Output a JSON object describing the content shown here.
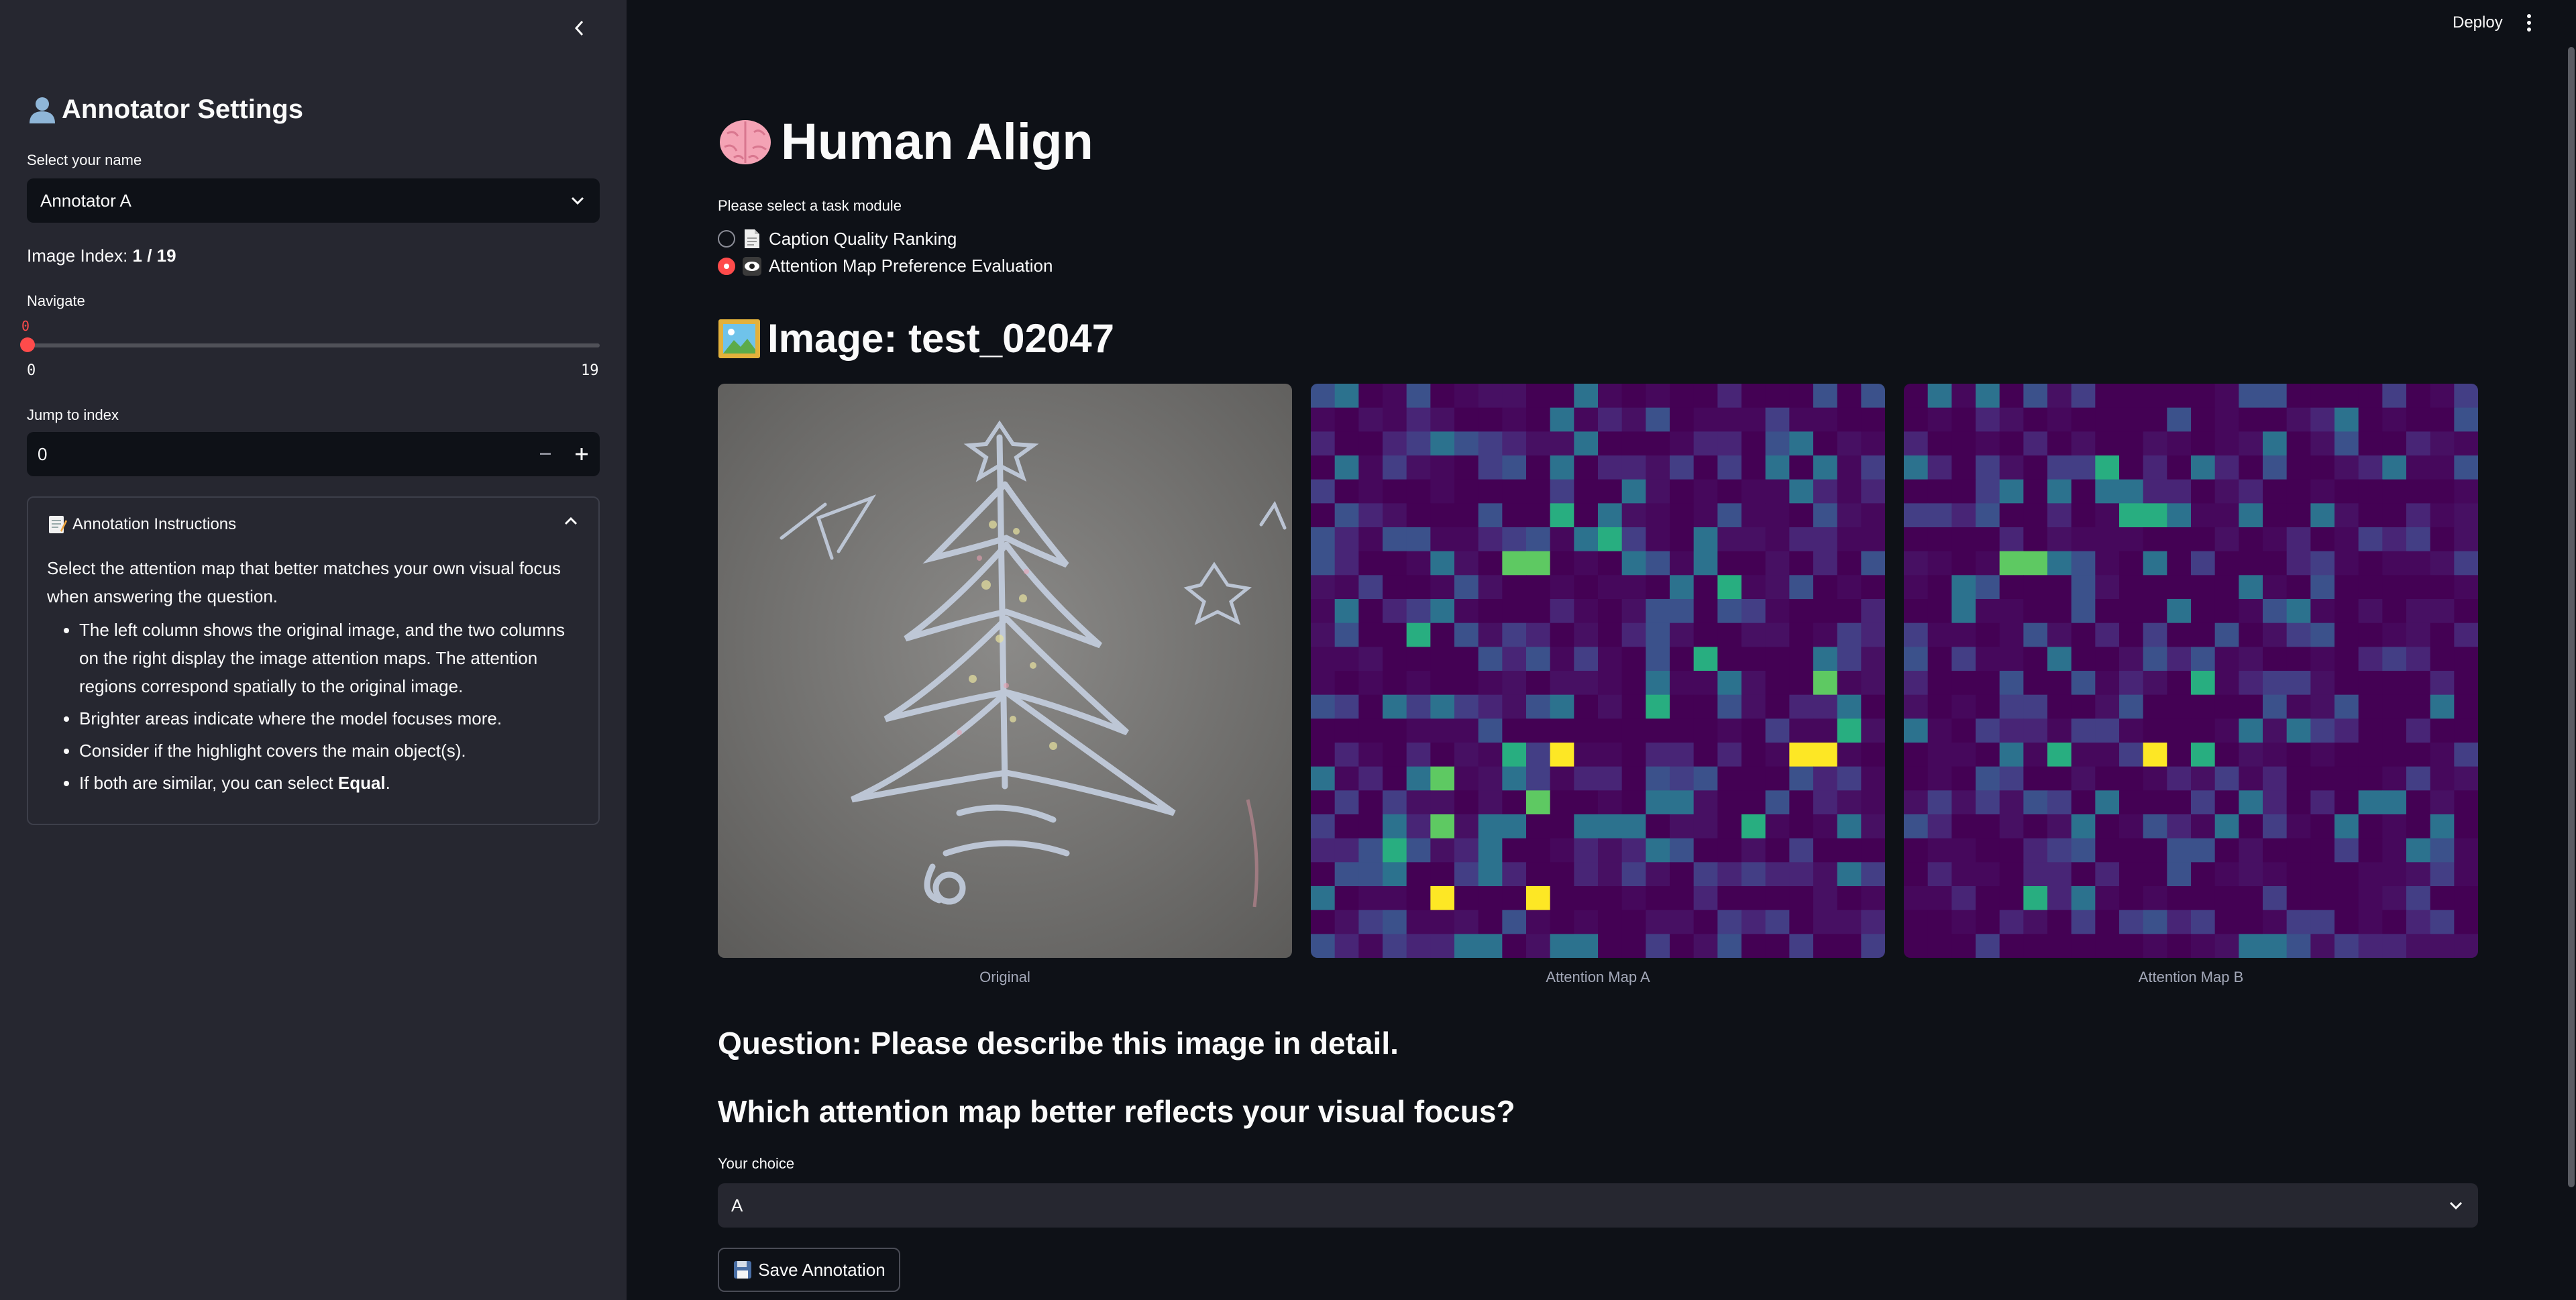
{
  "sidebar": {
    "title": "Annotator Settings",
    "name_label": "Select your name",
    "name_value": "Annotator A",
    "image_index_prefix": "Image Index: ",
    "image_index_value": "1 / 19",
    "navigate_label": "Navigate",
    "slider_value": "0",
    "slider_min": "0",
    "slider_max": "19",
    "jump_label": "Jump to index",
    "jump_value": "0",
    "instructions": {
      "title": "Annotation Instructions",
      "intro": "Select the attention map that better matches your own visual focus when answering the question.",
      "bullets": [
        "The left column shows the original image, and the two columns on the right display the image attention maps. The attention regions correspond spatially to the original image.",
        "Brighter areas indicate where the model focuses more.",
        "Consider if the highlight covers the main object(s)."
      ],
      "last_bullet_prefix": "If both are similar, you can select ",
      "last_bullet_bold": "Equal",
      "last_bullet_suffix": "."
    }
  },
  "header": {
    "deploy": "Deploy"
  },
  "main": {
    "title": "Human Align",
    "task_label": "Please select a task module",
    "tasks": [
      {
        "label": "Caption Quality Ranking",
        "selected": false
      },
      {
        "label": "Attention Map Preference Evaluation",
        "selected": true
      }
    ],
    "image_title": "Image: test_02047",
    "captions": [
      "Original",
      "Attention Map A",
      "Attention Map B"
    ],
    "question": "Question: Please describe this image in detail.",
    "which_question": "Which attention map better reflects your visual focus?",
    "choice_label": "Your choice",
    "choice_value": "A",
    "save_label": "Save Annotation"
  },
  "colors": {
    "background": "#0e1117",
    "sidebar": "#262730",
    "accent": "#ff4b4b",
    "viridis_low": "#440154",
    "viridis_high": "#fde725"
  }
}
